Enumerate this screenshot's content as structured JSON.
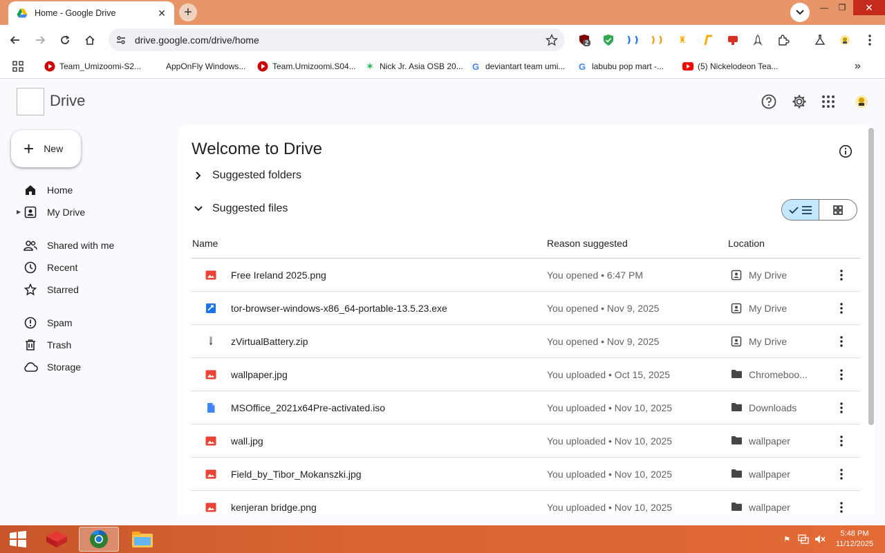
{
  "browser": {
    "tab_title": "Home - Google Drive",
    "url": "drive.google.com/drive/home",
    "extension_badge": "2",
    "bookmarks": [
      {
        "label": "Team_Umizoomi-S2...",
        "icon": "youtube-icon"
      },
      {
        "label": "AppOnFly Windows...",
        "icon": "appOnFly-icon"
      },
      {
        "label": "Team.Umizoomi.S04...",
        "icon": "youtube-icon"
      },
      {
        "label": "Nick Jr. Asia OSB 20...",
        "icon": "green-star-icon"
      },
      {
        "label": "deviantart team umi...",
        "icon": "google-icon"
      },
      {
        "label": "labubu pop mart -...",
        "icon": "google-icon"
      },
      {
        "label": "(5) Nickelodeon Tea...",
        "icon": "youtube-icon"
      }
    ]
  },
  "drive": {
    "app_title": "Drive",
    "new_label": "New",
    "nav": [
      {
        "label": "Home",
        "icon": "home-icon"
      },
      {
        "label": "My Drive",
        "icon": "my-drive-icon"
      },
      {
        "label": "Shared with me",
        "icon": "shared-icon"
      },
      {
        "label": "Recent",
        "icon": "clock-icon"
      },
      {
        "label": "Starred",
        "icon": "star-icon"
      },
      {
        "label": "Spam",
        "icon": "spam-icon"
      },
      {
        "label": "Trash",
        "icon": "trash-icon"
      },
      {
        "label": "Storage",
        "icon": "cloud-icon"
      }
    ],
    "welcome": "Welcome to Drive",
    "suggested_folders": "Suggested folders",
    "suggested_files": "Suggested files",
    "columns": {
      "name": "Name",
      "reason": "Reason suggested",
      "location": "Location"
    },
    "files": [
      {
        "name": "Free Ireland 2025.png",
        "type": "image",
        "reason": "You opened • 6:47 PM",
        "location": "My Drive",
        "loc_type": "drive"
      },
      {
        "name": "tor-browser-windows-x86_64-portable-13.5.23.exe",
        "type": "exe",
        "reason": "You opened • Nov 9, 2025",
        "location": "My Drive",
        "loc_type": "drive"
      },
      {
        "name": "zVirtualBattery.zip",
        "type": "zip",
        "reason": "You opened • Nov 9, 2025",
        "location": "My Drive",
        "loc_type": "drive"
      },
      {
        "name": "wallpaper.jpg",
        "type": "image",
        "reason": "You uploaded • Oct 15, 2025",
        "location": "Chromeboo...",
        "loc_type": "folder"
      },
      {
        "name": "MSOffice_2021x64Pre-activated.iso",
        "type": "doc",
        "reason": "You uploaded • Nov 10, 2025",
        "location": "Downloads",
        "loc_type": "folder"
      },
      {
        "name": "wall.jpg",
        "type": "image",
        "reason": "You uploaded • Nov 10, 2025",
        "location": "wallpaper",
        "loc_type": "folder"
      },
      {
        "name": "Field_by_Tibor_Mokanszki.jpg",
        "type": "image",
        "reason": "You uploaded • Nov 10, 2025",
        "location": "wallpaper",
        "loc_type": "folder"
      },
      {
        "name": "kenjeran bridge.png",
        "type": "image",
        "reason": "You uploaded • Nov 10, 2025",
        "location": "wallpaper",
        "loc_type": "folder"
      }
    ]
  },
  "taskbar": {
    "time": "5:48 PM",
    "date": "11/12/2025"
  },
  "colors": {
    "titlebar": "#e8956a",
    "accent_blue": "#c2e7ff",
    "image_red": "#ea4335",
    "doc_blue": "#4285f4",
    "taskbar": "#d96533"
  }
}
